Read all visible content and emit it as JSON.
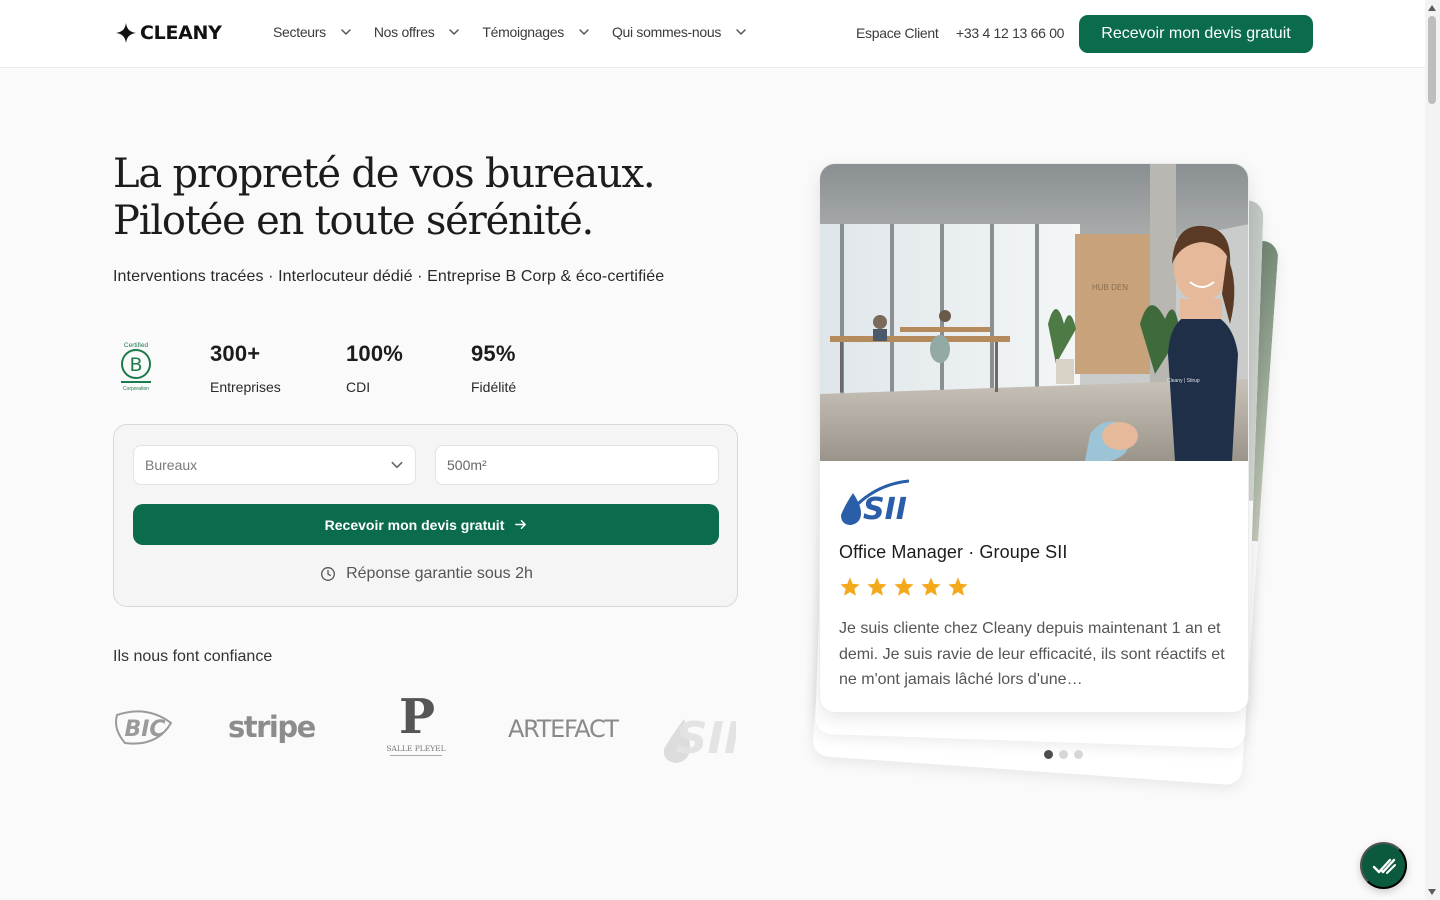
{
  "brand": {
    "name": "CLEANY",
    "accent_color": "#0b6b4d"
  },
  "nav": {
    "menu": [
      {
        "label": "Secteurs"
      },
      {
        "label": "Nos offres"
      },
      {
        "label": "Témoignages"
      },
      {
        "label": "Qui sommes-nous"
      }
    ],
    "client_label": "Espace Client",
    "phone": "+33 4 12 13 66 00",
    "cta_label": "Recevoir mon devis gratuit"
  },
  "hero": {
    "title_line1": "La propreté de vos bureaux.",
    "title_line2": "Pilotée en toute sérénité.",
    "subtitle": "Interventions tracées · Interlocuteur dédié · Entreprise B Corp & éco-certifiée"
  },
  "certification": {
    "badge_icon": "b-corp-certified-icon",
    "top_text": "Certified",
    "letter": "B",
    "bottom_text": "Corporation"
  },
  "stats": [
    {
      "value": "300+",
      "label": "Entreprises"
    },
    {
      "value": "100%",
      "label": "CDI"
    },
    {
      "value": "95%",
      "label": "Fidélité"
    }
  ],
  "quote_form": {
    "premises_type_selected": "Bureaux",
    "surface_placeholder": "500m²",
    "submit_label": "Recevoir mon devis gratuit",
    "guarantee_text": "Réponse garantie sous 2h"
  },
  "trust": {
    "title": "Ils nous font confiance",
    "logos": [
      {
        "name": "bic-logo",
        "text": "BIC"
      },
      {
        "name": "stripe-logo",
        "text": "stripe"
      },
      {
        "name": "salle-pleyel-logo",
        "text": "P",
        "caption": "SALLE PLEYEL"
      },
      {
        "name": "artefact-logo",
        "text": "ARTEFACT"
      },
      {
        "name": "sii-logo",
        "text": "SII"
      }
    ]
  },
  "testimonial": {
    "role": "Office Manager · Groupe SII",
    "rating": 5,
    "quote": "Je suis cliente chez Cleany depuis maintenant 1 an et demi. Je suis ravie de leur efficacité, ils sont réactifs et ne m'ont jamais lâché lors d'une…",
    "total_slides": 3,
    "active_slide": 1,
    "photo_shirt_text": "Cleany | Stirup",
    "photo_wall_sign": "HUB DEN"
  },
  "colors": {
    "star": "#f4a81c",
    "logo_grey": "#8c8c8c",
    "page_bg": "#fafafa"
  }
}
